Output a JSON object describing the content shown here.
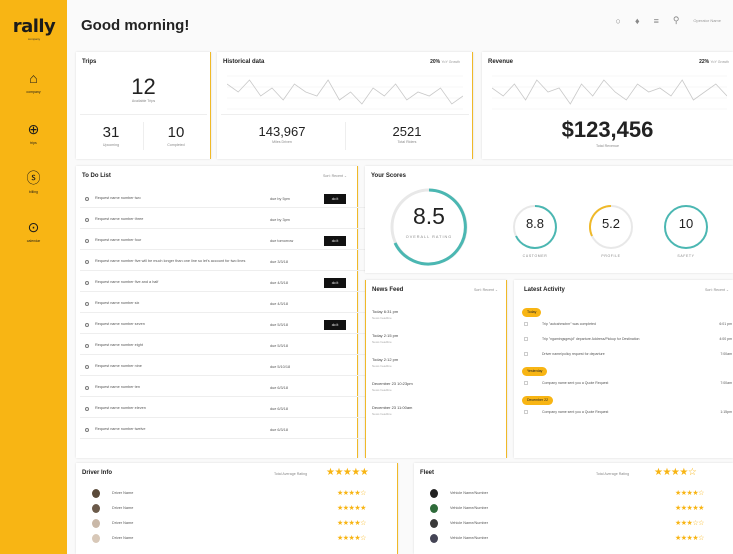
{
  "brand": {
    "logo": "rally",
    "logo_sub": "company"
  },
  "nav": [
    {
      "label": "company",
      "icon": "home-icon"
    },
    {
      "label": "trips",
      "icon": "steering-wheel-icon"
    },
    {
      "label": "billing",
      "icon": "dollar-icon"
    },
    {
      "label": "calendar",
      "icon": "target-icon"
    }
  ],
  "header": {
    "greeting": "Good morning!",
    "user": "Operator Name"
  },
  "trips": {
    "title": "Trips",
    "available": "12",
    "available_label": "Available Trips",
    "upcoming": "31",
    "upcoming_label": "Upcoming",
    "completed": "10",
    "completed_label": "Completed"
  },
  "historical": {
    "title": "Historical data",
    "pct": "20%",
    "pct_note": "YoY Growth",
    "miles": "143,967",
    "miles_label": "Miles Driven",
    "riders": "2521",
    "riders_label": "Total Riders",
    "sparkline": [
      8,
      6,
      9,
      5,
      7,
      4,
      8,
      6,
      5,
      9,
      4,
      6,
      3,
      7,
      5,
      8,
      4,
      6,
      5,
      7,
      3,
      5
    ]
  },
  "revenue": {
    "title": "Revenue",
    "pct": "22%",
    "pct_note": "YoY Growth",
    "amount": "$123,456",
    "amount_label": "Total Revenue",
    "sparkline": [
      7,
      5,
      8,
      4,
      9,
      6,
      7,
      3,
      8,
      5,
      9,
      6,
      4,
      8,
      6,
      7,
      5,
      9,
      4,
      6,
      8,
      5
    ]
  },
  "todo": {
    "title": "To Do List",
    "filter": "Sort: Recent",
    "items": [
      {
        "name": "Request name number two",
        "due": "due by 5pm",
        "action": "do it"
      },
      {
        "name": "Request name number three",
        "due": "due by 3pm",
        "action": ""
      },
      {
        "name": "Request name number four",
        "due": "due tomorrow",
        "action": "do it"
      },
      {
        "name": "Request name number five will be much longer than one line so let's account for two lines",
        "due": "due 3/3/18",
        "action": ""
      },
      {
        "name": "Request name number five and a half",
        "due": "due 4/3/18",
        "action": "do it"
      },
      {
        "name": "Request name number six",
        "due": "due 4/3/18",
        "action": ""
      },
      {
        "name": "Request name number seven",
        "due": "due 5/3/18",
        "action": "do it"
      },
      {
        "name": "Request name number eight",
        "due": "due 5/3/18",
        "action": ""
      },
      {
        "name": "Request name number nine",
        "due": "due 5/10/18",
        "action": ""
      },
      {
        "name": "Request name number ten",
        "due": "due 6/3/18",
        "action": ""
      },
      {
        "name": "Request name number eleven",
        "due": "due 6/3/18",
        "action": ""
      },
      {
        "name": "Request name number twelve",
        "due": "due 6/3/18",
        "action": ""
      }
    ]
  },
  "scores": {
    "title": "Your Scores",
    "overall": "8.5",
    "overall_label": "OVERALL RATING",
    "items": [
      {
        "value": "8.8",
        "label": "CUSTOMER"
      },
      {
        "value": "5.2",
        "label": "PROFILE"
      },
      {
        "value": "10",
        "label": "SAFETY"
      }
    ]
  },
  "news": {
    "title": "News Feed",
    "filter": "Sort: Recent",
    "items": [
      {
        "time": "Today 6:31 pm",
        "sub": "News headline"
      },
      {
        "time": "Today 2:15 pm",
        "sub": "News headline"
      },
      {
        "time": "Today 2:12 pm",
        "sub": "News headline"
      },
      {
        "time": "December 23 10:23pm",
        "sub": "News headline"
      },
      {
        "time": "December 23 11:00am",
        "sub": "News headline"
      }
    ]
  },
  "activity": {
    "title": "Latest Activity",
    "filter": "Sort: Recent",
    "groups": [
      {
        "tag": "Today",
        "rows": [
          {
            "text": "Trip \"autcahmcbnr\" was completed",
            "time": "6:01 pm"
          },
          {
            "text": "Trip \"ngamingsgesjd\" departure Address/Pickup for Destination",
            "time": "4:00 pm"
          },
          {
            "text": "Driver name/policy request for departure",
            "time": "7:00am"
          }
        ]
      },
      {
        "tag": "Yesterday",
        "rows": [
          {
            "text": "Company name sent you a Quote Request",
            "time": "7:00am"
          }
        ]
      },
      {
        "tag": "December 22",
        "rows": [
          {
            "text": "Company name sent you a Quote Request",
            "time": "1:15pm"
          }
        ]
      }
    ]
  },
  "drivers": {
    "title": "Driver Info",
    "avg_label": "Total Average Rating",
    "rows": [
      {
        "name": "Driver Name",
        "stars": "★★★★☆"
      },
      {
        "name": "Driver Name",
        "stars": "★★★★★"
      },
      {
        "name": "Driver Name",
        "stars": "★★★★☆"
      },
      {
        "name": "Driver Name",
        "stars": "★★★★☆"
      }
    ]
  },
  "fleet": {
    "title": "Fleet",
    "avg_label": "Total Average Rating",
    "rows": [
      {
        "name": "Vehicle Name/Number",
        "stars": "★★★★☆"
      },
      {
        "name": "Vehicle Name/Number",
        "stars": "★★★★★"
      },
      {
        "name": "Vehicle Name/Number",
        "stars": "★★★☆☆"
      },
      {
        "name": "Vehicle Name/Number",
        "stars": "★★★★☆"
      }
    ]
  },
  "colors": {
    "brand": "#f8b514",
    "ring_teal": "#4bb7b2",
    "ring_gold": "#f0b928"
  }
}
